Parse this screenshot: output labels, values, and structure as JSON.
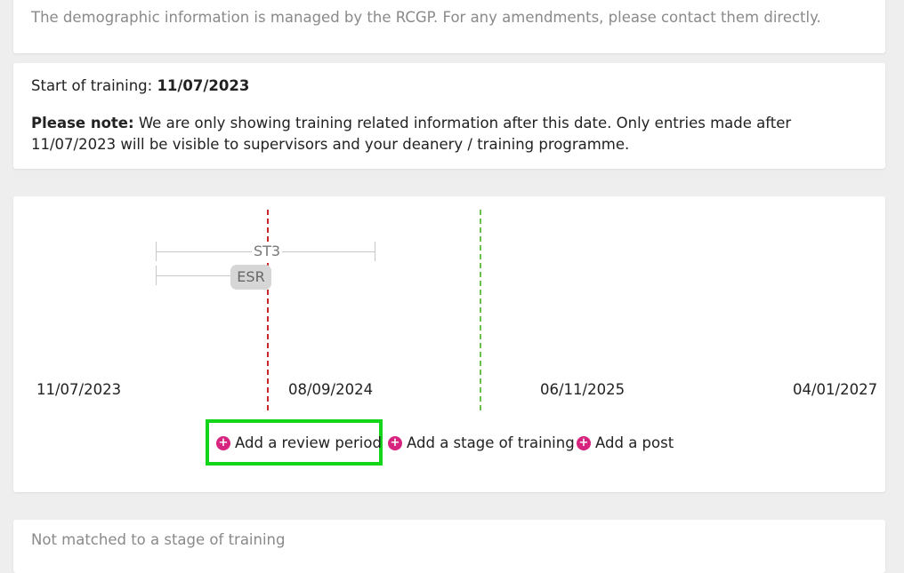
{
  "demographic": {
    "text": "The demographic information is managed by the RCGP. For any amendments, please contact them directly."
  },
  "training_start": {
    "label": "Start of training: ",
    "date": "11/07/2023",
    "note_bold": "Please note:",
    "note_text": " We are only showing training related information after this date. Only entries made after 11/07/2023 will be visible to supervisors and your deanery / training programme."
  },
  "timeline": {
    "axis_labels": [
      "11/07/2023",
      "08/09/2024",
      "06/11/2025",
      "04/01/2027"
    ],
    "stages": [
      {
        "label": "ST3"
      }
    ],
    "reviews": [
      {
        "label": "ESR"
      }
    ],
    "colors": {
      "today_line": "#c62828",
      "future_line": "#6cc04a",
      "accent": "#d6247f",
      "highlight": "#15d51a"
    }
  },
  "actions": {
    "add_review_period": "Add a review period",
    "add_stage": "Add a stage of training",
    "add_post": "Add a post",
    "icon": "plus-circle-icon"
  },
  "unmatched": {
    "title": "Not matched to a stage of training"
  }
}
